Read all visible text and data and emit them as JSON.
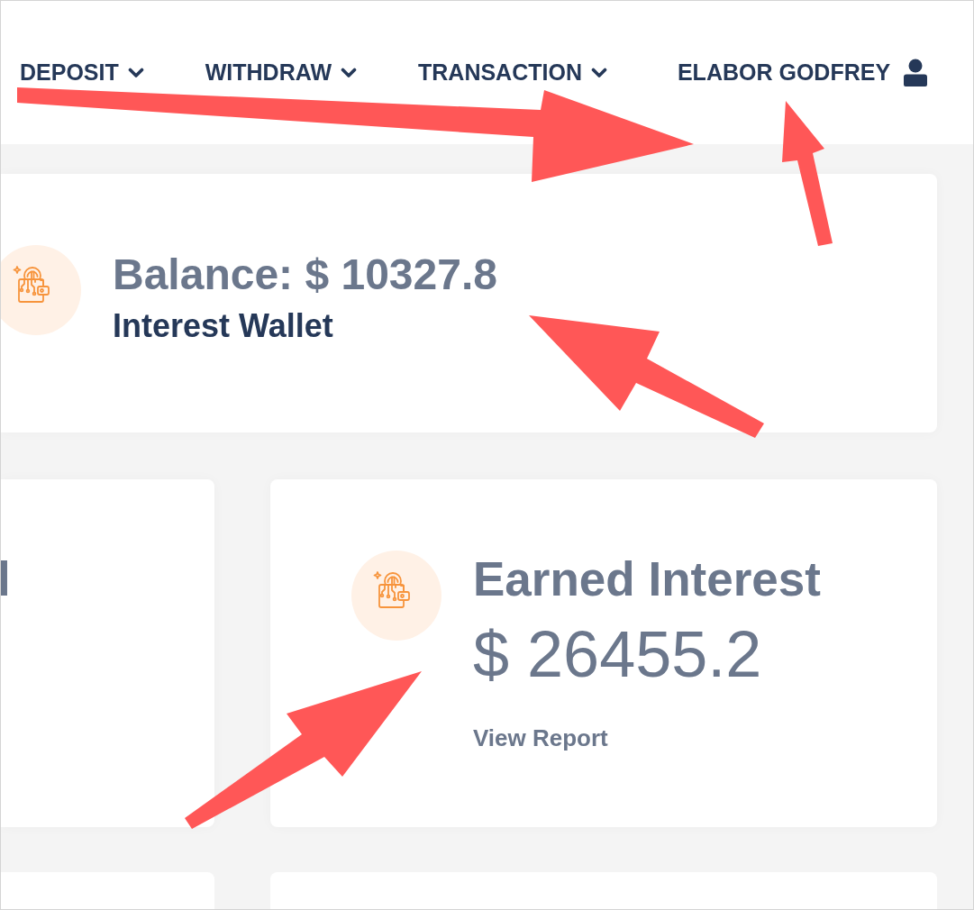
{
  "header": {
    "nav_items": [
      {
        "label": "DEPOSIT"
      },
      {
        "label": "WITHDRAW"
      },
      {
        "label": "TRANSACTION"
      }
    ],
    "user": {
      "name": "ELABOR GODFREY"
    }
  },
  "balance_card": {
    "title": "Balance: $ 10327.8",
    "subtitle": "Interest Wallet"
  },
  "stat_cards": [
    {
      "kind": "partial",
      "title": "l"
    },
    {
      "kind": "full",
      "title": "Earned Interest",
      "amount": "$ 26455.2",
      "link": "View Report"
    }
  ]
}
